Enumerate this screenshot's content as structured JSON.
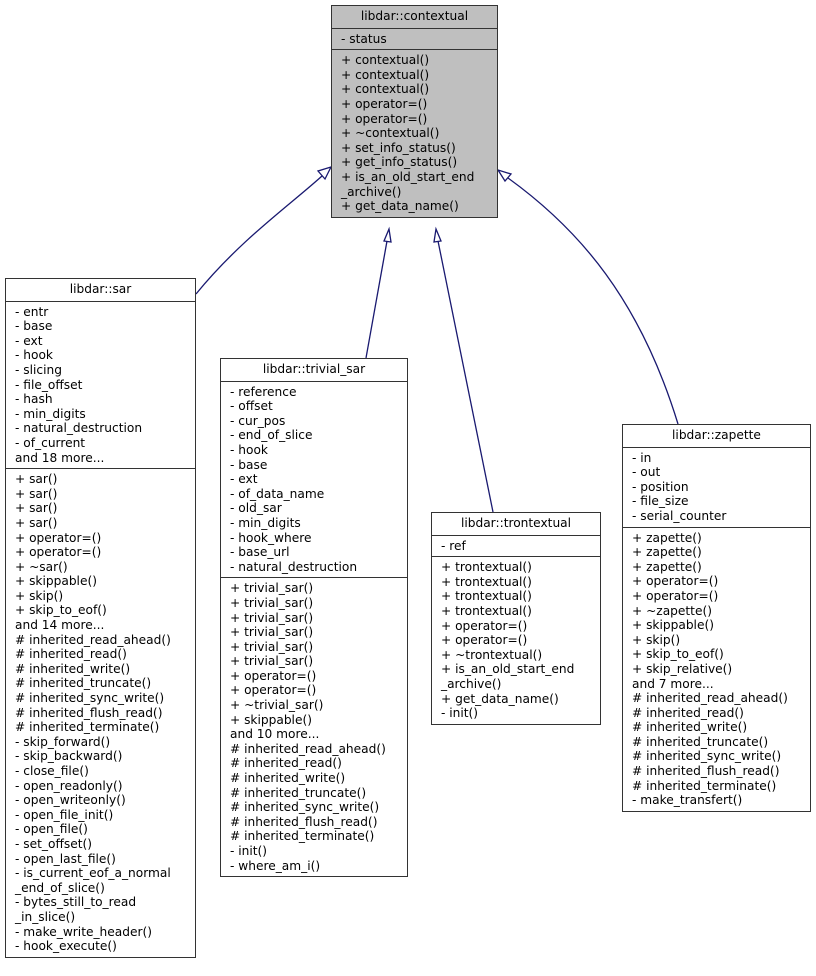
{
  "colors": {
    "edge": "#191970",
    "base_fill": "#bfbfbf",
    "node_fill": "#ffffff",
    "border": "#333333"
  },
  "nodes": {
    "contextual": {
      "title": "libdar::contextual",
      "attributes": [
        "- status"
      ],
      "methods": [
        "+ contextual()",
        "+ contextual()",
        "+ contextual()",
        "+ operator=()",
        "+ operator=()",
        "+ ~contextual()",
        "+ set_info_status()",
        "+ get_info_status()",
        "+ is_an_old_start_end",
        "_archive()",
        "+ get_data_name()"
      ]
    },
    "sar": {
      "title": "libdar::sar",
      "attributes": [
        "- entr",
        "- base",
        "- ext",
        "- hook",
        "- slicing",
        "- file_offset",
        "- hash",
        "- min_digits",
        "- natural_destruction",
        "- of_current",
        "and 18 more..."
      ],
      "methods": [
        "+ sar()",
        "+ sar()",
        "+ sar()",
        "+ sar()",
        "+ operator=()",
        "+ operator=()",
        "+ ~sar()",
        "+ skippable()",
        "+ skip()",
        "+ skip_to_eof()",
        "and 14 more...",
        "# inherited_read_ahead()",
        "# inherited_read()",
        "# inherited_write()",
        "# inherited_truncate()",
        "# inherited_sync_write()",
        "# inherited_flush_read()",
        "# inherited_terminate()",
        "- skip_forward()",
        "- skip_backward()",
        "- close_file()",
        "- open_readonly()",
        "- open_writeonly()",
        "- open_file_init()",
        "- open_file()",
        "- set_offset()",
        "- open_last_file()",
        "- is_current_eof_a_normal",
        "_end_of_slice()",
        "- bytes_still_to_read",
        "_in_slice()",
        "- make_write_header()",
        "- hook_execute()"
      ]
    },
    "trivial_sar": {
      "title": "libdar::trivial_sar",
      "attributes": [
        "- reference",
        "- offset",
        "- cur_pos",
        "- end_of_slice",
        "- hook",
        "- base",
        "- ext",
        "- of_data_name",
        "- old_sar",
        "- min_digits",
        "- hook_where",
        "- base_url",
        "- natural_destruction"
      ],
      "methods": [
        "+ trivial_sar()",
        "+ trivial_sar()",
        "+ trivial_sar()",
        "+ trivial_sar()",
        "+ trivial_sar()",
        "+ trivial_sar()",
        "+ operator=()",
        "+ operator=()",
        "+ ~trivial_sar()",
        "+ skippable()",
        "and 10 more...",
        "# inherited_read_ahead()",
        "# inherited_read()",
        "# inherited_write()",
        "# inherited_truncate()",
        "# inherited_sync_write()",
        "# inherited_flush_read()",
        "# inherited_terminate()",
        "- init()",
        "- where_am_i()"
      ]
    },
    "trontextual": {
      "title": "libdar::trontextual",
      "attributes": [
        "- ref"
      ],
      "methods": [
        "+ trontextual()",
        "+ trontextual()",
        "+ trontextual()",
        "+ trontextual()",
        "+ operator=()",
        "+ operator=()",
        "+ ~trontextual()",
        "+ is_an_old_start_end",
        "_archive()",
        "+ get_data_name()",
        "- init()"
      ]
    },
    "zapette": {
      "title": "libdar::zapette",
      "attributes": [
        "- in",
        "- out",
        "- position",
        "- file_size",
        "- serial_counter"
      ],
      "methods": [
        "+ zapette()",
        "+ zapette()",
        "+ zapette()",
        "+ operator=()",
        "+ operator=()",
        "+ ~zapette()",
        "+ skippable()",
        "+ skip()",
        "+ skip_to_eof()",
        "+ skip_relative()",
        "and 7 more...",
        "# inherited_read_ahead()",
        "# inherited_read()",
        "# inherited_write()",
        "# inherited_truncate()",
        "# inherited_sync_write()",
        "# inherited_flush_read()",
        "# inherited_terminate()",
        "- make_transfert()"
      ]
    }
  },
  "edges": [
    {
      "from": "sar",
      "to": "contextual",
      "type": "inheritance"
    },
    {
      "from": "trivial_sar",
      "to": "contextual",
      "type": "inheritance"
    },
    {
      "from": "trontextual",
      "to": "contextual",
      "type": "inheritance"
    },
    {
      "from": "zapette",
      "to": "contextual",
      "type": "inheritance"
    }
  ]
}
